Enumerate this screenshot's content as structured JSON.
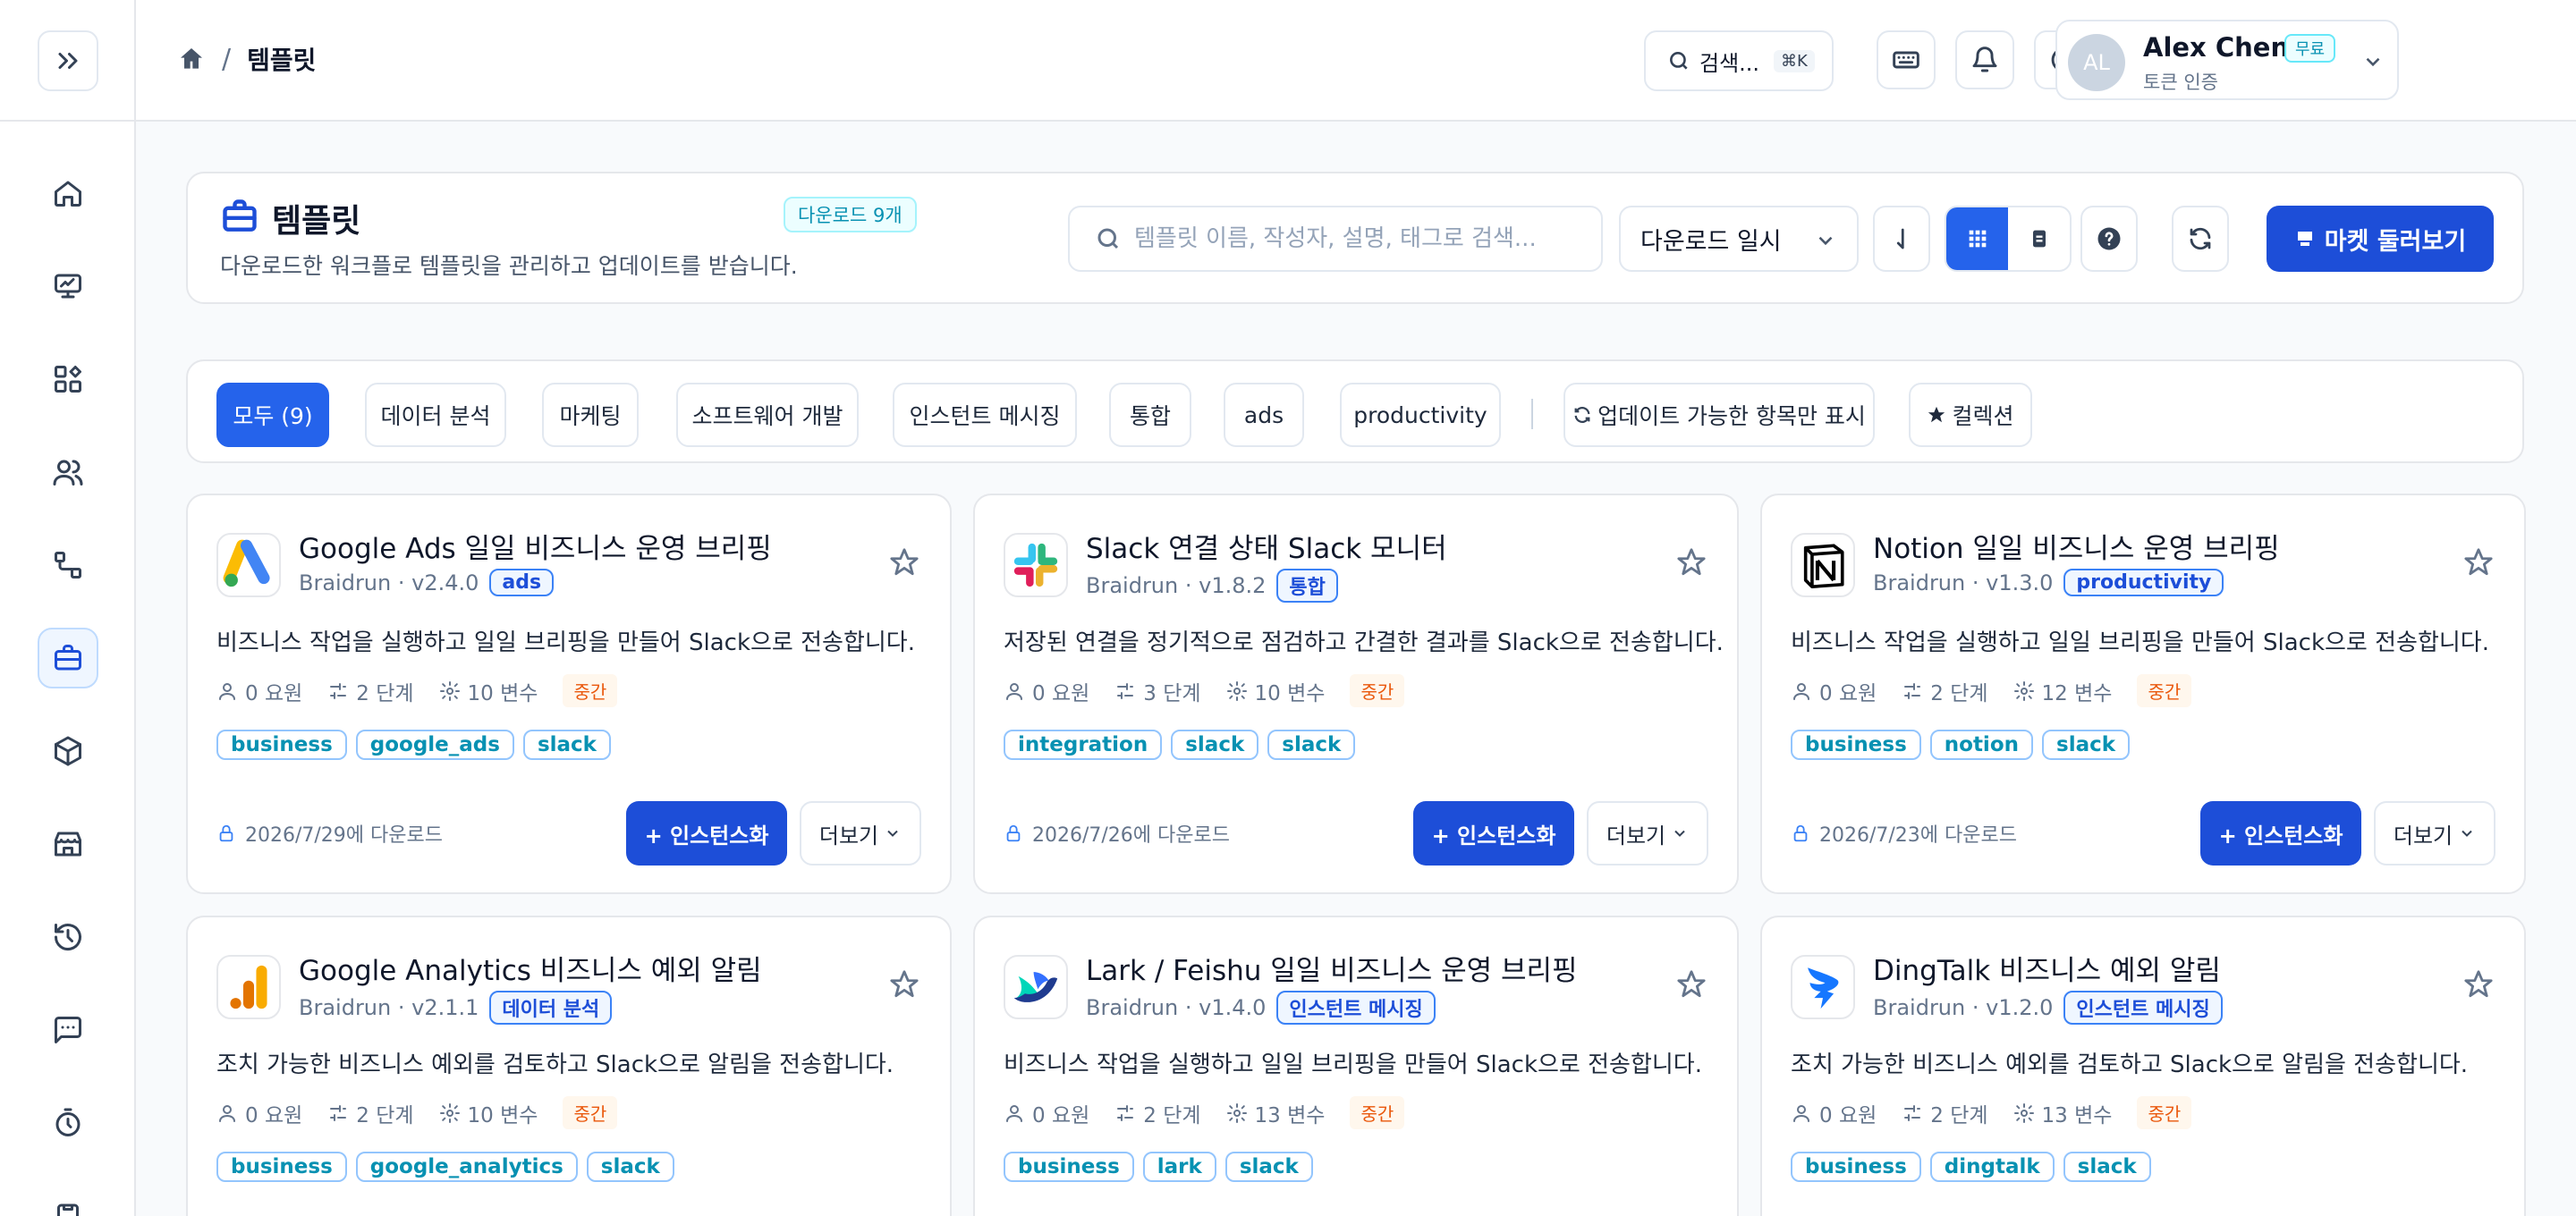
{
  "header": {
    "breadcrumb_current": "템플릿",
    "breadcrumb_sep": "/",
    "search_label": "검색...",
    "search_shortcut": "⌘K"
  },
  "user": {
    "initials": "AL",
    "name": "Alex Chen",
    "plan_badge": "무료",
    "subtitle": "토큰 인증"
  },
  "panel": {
    "title": "템플릿",
    "download_badge": "다운로드 9개",
    "subtitle": "다운로드한 워크플로 템플릿을 관리하고 업데이트를 받습니다.",
    "search_placeholder": "템플릿 이름, 작성자, 설명, 태그로 검색...",
    "sort_value": "다운로드 일시",
    "market_button": "마켓 둘러보기"
  },
  "filters": {
    "chips": [
      "모두 (9)",
      "데이터 분석",
      "마케팅",
      "소프트웨어 개발",
      "인스턴트 메시징",
      "통합",
      "ads",
      "productivity"
    ],
    "updatable_only": "업데이트 가능한 항목만 표시",
    "collection": "컬렉션"
  },
  "cards": [
    {
      "title": "Google Ads 일일 비즈니스 운영 브리핑",
      "meta": "Braidrun · v2.4.0",
      "category": "ads",
      "description": "비즈니스 작업을 실행하고 일일 브리핑을 만들어 Slack으로 전송합니다.",
      "members": "0 요원",
      "steps": "2 단계",
      "vars": "10 변수",
      "difficulty": "중간",
      "tags": [
        "business",
        "google_ads",
        "slack"
      ],
      "date": "2026/7/29에 다운로드",
      "instantiate": "+ 인스턴스화",
      "more": "더보기",
      "logo": "google-ads-logo"
    },
    {
      "title": "Slack 연결 상태 Slack 모니터",
      "meta": "Braidrun · v1.8.2",
      "category": "통합",
      "description": "저장된 연결을 정기적으로 점검하고 간결한 결과를 Slack으로 전송합니다.",
      "members": "0 요원",
      "steps": "3 단계",
      "vars": "10 변수",
      "difficulty": "중간",
      "tags": [
        "integration",
        "slack",
        "slack"
      ],
      "date": "2026/7/26에 다운로드",
      "instantiate": "+ 인스턴스화",
      "more": "더보기",
      "logo": "slack-logo"
    },
    {
      "title": "Notion 일일 비즈니스 운영 브리핑",
      "meta": "Braidrun · v1.3.0",
      "category": "productivity",
      "description": "비즈니스 작업을 실행하고 일일 브리핑을 만들어 Slack으로 전송합니다.",
      "members": "0 요원",
      "steps": "2 단계",
      "vars": "12 변수",
      "difficulty": "중간",
      "tags": [
        "business",
        "notion",
        "slack"
      ],
      "date": "2026/7/23에 다운로드",
      "instantiate": "+ 인스턴스화",
      "more": "더보기",
      "logo": "notion-logo"
    },
    {
      "title": "Google Analytics 비즈니스 예외 알림",
      "meta": "Braidrun · v2.1.1",
      "category": "데이터 분석",
      "description": "조치 가능한 비즈니스 예외를 검토하고 Slack으로 알림을 전송합니다.",
      "members": "0 요원",
      "steps": "2 단계",
      "vars": "10 변수",
      "difficulty": "중간",
      "tags": [
        "business",
        "google_analytics",
        "slack"
      ],
      "logo": "google-analytics-logo"
    },
    {
      "title": "Lark / Feishu 일일 비즈니스 운영 브리핑",
      "meta": "Braidrun · v1.4.0",
      "category": "인스턴트 메시징",
      "description": "비즈니스 작업을 실행하고 일일 브리핑을 만들어 Slack으로 전송합니다.",
      "members": "0 요원",
      "steps": "2 단계",
      "vars": "13 변수",
      "difficulty": "중간",
      "tags": [
        "business",
        "lark",
        "slack"
      ],
      "logo": "lark-logo"
    },
    {
      "title": "DingTalk 비즈니스 예외 알림",
      "meta": "Braidrun · v1.2.0",
      "category": "인스턴트 메시징",
      "description": "조치 가능한 비즈니스 예외를 검토하고 Slack으로 알림을 전송합니다.",
      "members": "0 요원",
      "steps": "2 단계",
      "vars": "13 변수",
      "difficulty": "중간",
      "tags": [
        "business",
        "dingtalk",
        "slack"
      ],
      "logo": "dingtalk-logo"
    }
  ]
}
